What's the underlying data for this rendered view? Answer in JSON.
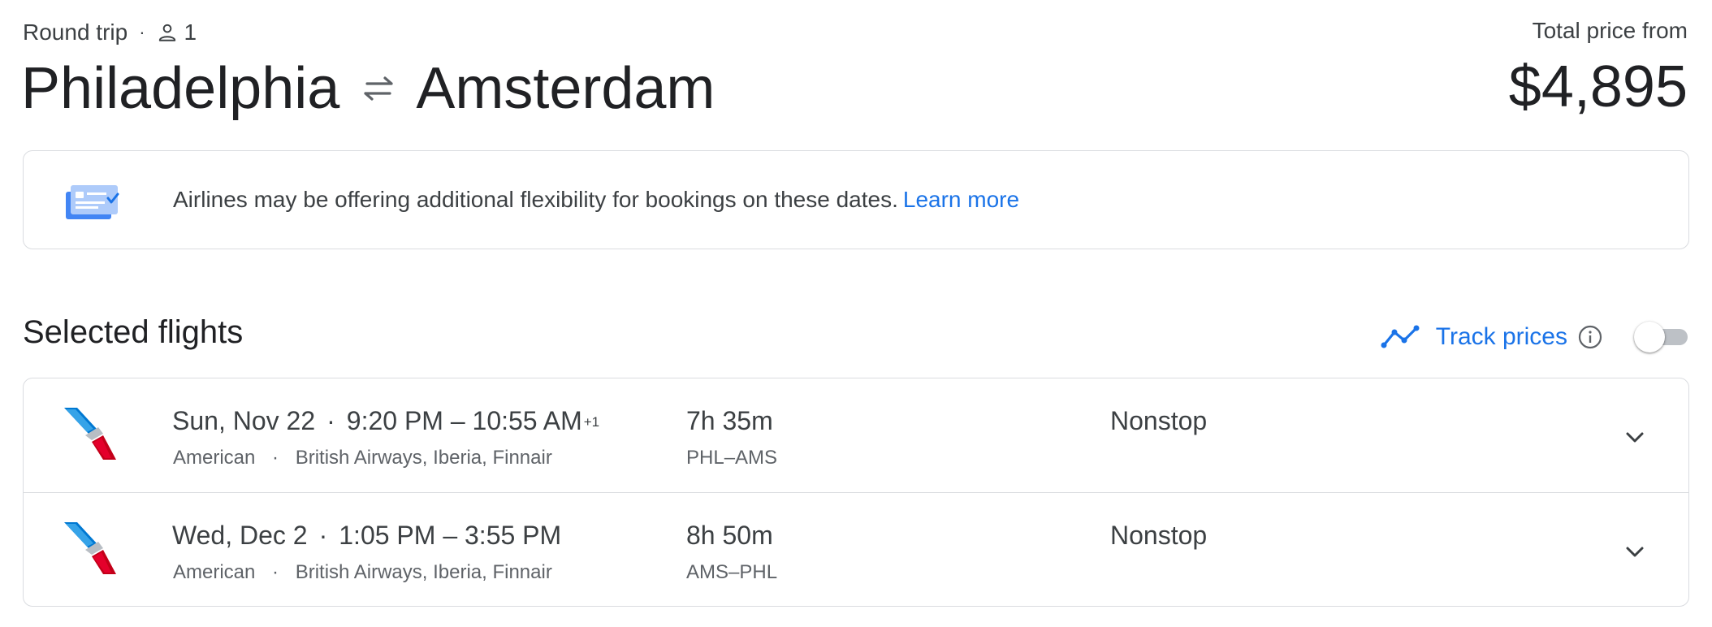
{
  "header": {
    "trip_type": "Round trip",
    "dot": "·",
    "passengers": "1",
    "origin": "Philadelphia",
    "destination": "Amsterdam",
    "price_label": "Total price from",
    "price": "$4,895"
  },
  "notice": {
    "text": "Airlines may be offering additional flexibility for bookings on these dates.",
    "link": "Learn more"
  },
  "section": {
    "title": "Selected flights",
    "track_label": "Track prices",
    "track_enabled": false
  },
  "flights": [
    {
      "date": "Sun, Nov 22",
      "dot": "·",
      "times": "9:20 PM – 10:55 AM",
      "day_offset": "+1",
      "airline": "American",
      "partners": "British Airways, Iberia, Finnair",
      "duration": "7h 35m",
      "route": "PHL–AMS",
      "stops": "Nonstop"
    },
    {
      "date": "Wed, Dec 2",
      "dot": "·",
      "times": "1:05 PM – 3:55 PM",
      "day_offset": "",
      "airline": "American",
      "partners": "British Airways, Iberia, Finnair",
      "duration": "8h 50m",
      "route": "AMS–PHL",
      "stops": "Nonstop"
    }
  ],
  "icons": {
    "person": "person-icon",
    "swap": "swap-arrows-icon",
    "notice": "flexible-booking-icon",
    "trend": "price-trend-icon",
    "info": "info-icon",
    "expand": "chevron-down-icon",
    "airline_logo": "american-airlines-logo"
  },
  "colors": {
    "link": "#1a73e8",
    "text_primary": "#202124",
    "text_secondary": "#5f6368",
    "border": "#dadce0",
    "aa_blue": "#0078d2",
    "aa_red": "#c30019"
  }
}
